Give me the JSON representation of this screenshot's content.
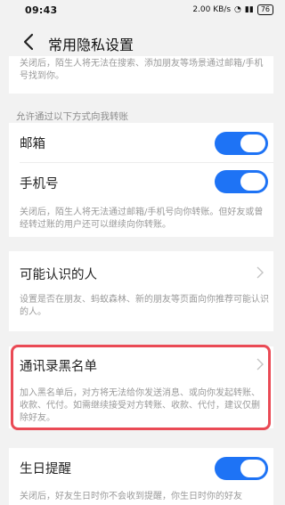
{
  "status": {
    "time": "09:43",
    "net": "2.00 KB/s",
    "battery": "76"
  },
  "nav": {
    "title": "常用隐私设置"
  },
  "top_note": "关闭后，陌生人将无法在搜索、添加朋友等场景通过邮箱/手机号找到你。",
  "transfer": {
    "section_title": "允许通过以下方式向我转账",
    "email_label": "邮箱",
    "phone_label": "手机号",
    "note": "关闭后，陌生人将无法通过邮箱/手机号向你转账。但好友或曾经转过账的用户还可以继续向你转账。"
  },
  "people": {
    "label": "可能认识的人",
    "note": "设置是否在朋友、蚂蚁森林、新的朋友等页面向你推荐可能认识的人。"
  },
  "blacklist": {
    "label": "通讯录黑名单",
    "note": "加入黑名单后，对方将无法给你发送消息、或向你发起转账、收款、代付。如需继续接受对方转账、收款、代付，建议仅删除好友。"
  },
  "birthday": {
    "label": "生日提醒",
    "note": "关闭后，好友生日时你不会收到提醒，你生日时你的好友"
  },
  "colors": {
    "accent": "#1e73f5",
    "highlight": "#ea4a55"
  }
}
